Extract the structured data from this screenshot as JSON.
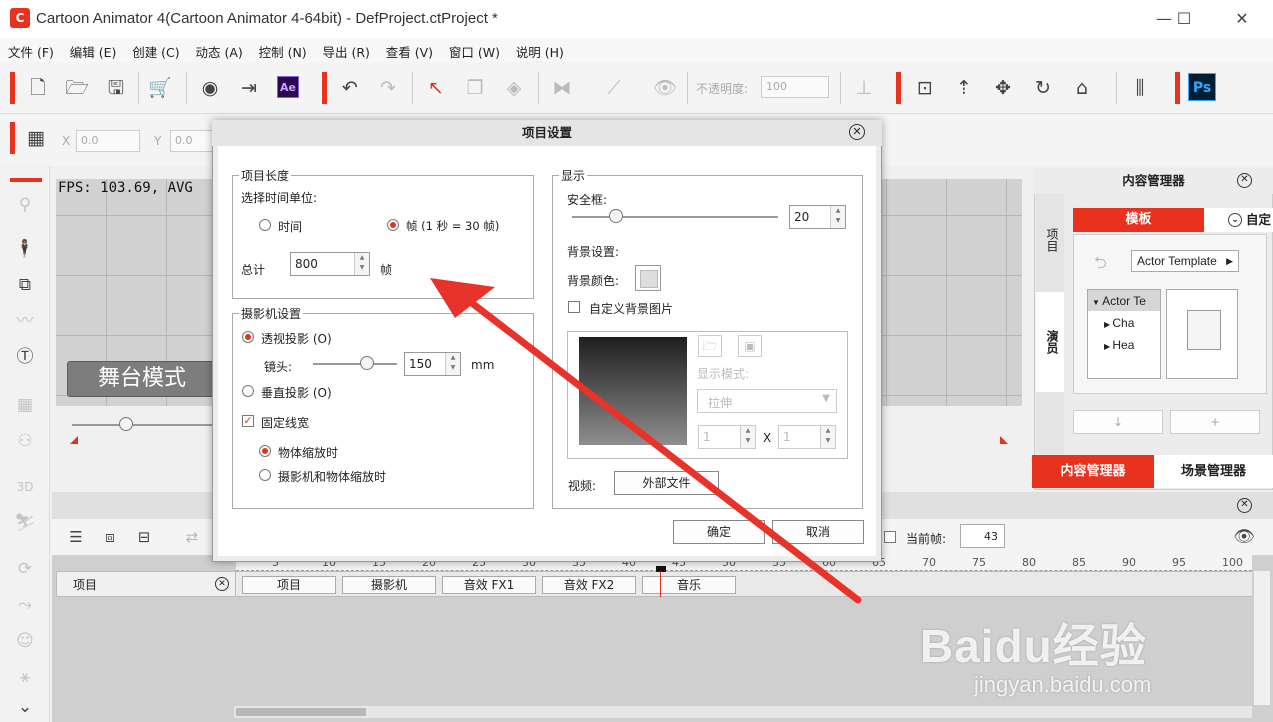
{
  "window": {
    "title": "Cartoon Animator 4(Cartoon Animator 4-64bit) - DefProject.ctProject *",
    "logo_letter": "C"
  },
  "menu": [
    "文件 (F)",
    "编辑 (E)",
    "创建 (C)",
    "动态 (A)",
    "控制 (N)",
    "导出 (R)",
    "查看 (V)",
    "窗口 (W)",
    "说明 (H)"
  ],
  "toolbar": {
    "opacity_label": "不透明度:",
    "opacity_value": "100",
    "ae_label": "Ae",
    "ps_label": "Ps"
  },
  "transform_bar": {
    "x_label": "X",
    "x_value": "0.0",
    "y_label": "Y",
    "y_value": "0.0"
  },
  "stage": {
    "fps_text": "FPS: 103.69, AVG",
    "mode_button": "舞台模式"
  },
  "content_manager": {
    "title": "内容管理器",
    "side_tabs": [
      "项目",
      "演员"
    ],
    "template_tab": "模板",
    "auto_tab": "自定",
    "actor_template_button": "Actor Template",
    "tree_items": [
      "Actor Te",
      "Cha",
      "Hea"
    ],
    "bottom_tabs": [
      "内容管理器",
      "场景管理器"
    ]
  },
  "timeline": {
    "current_frame_label": "当前帧:",
    "current_frame_value": "43",
    "track_header": "项目",
    "tracks": [
      "项目",
      "摄影机",
      "音效 FX1",
      "音效 FX2",
      "音乐"
    ],
    "ruler_ticks": [
      "5",
      "10",
      "15",
      "20",
      "25",
      "30",
      "35",
      "40",
      "45",
      "50",
      "55",
      "60",
      "65",
      "70",
      "75",
      "80",
      "85",
      "90",
      "95",
      "100"
    ]
  },
  "dialog": {
    "title": "项目设置",
    "project_length": {
      "group_title": "项目长度",
      "time_unit_label": "选择时间单位:",
      "time_option": "时间",
      "frame_option": "帧 (1 秒 = 30 帧)",
      "total_label": "总计",
      "total_value": "800",
      "unit": "帧"
    },
    "camera": {
      "group_title": "摄影机设置",
      "perspective": "透视投影 (O)",
      "lens_label": "镜头:",
      "lens_value": "150",
      "lens_unit": "mm",
      "orthographic": "垂直投影 (O)",
      "fixed_line": "固定线宽",
      "object_scale": "物体缩放时",
      "camera_object_scale": "摄影机和物体缩放时"
    },
    "display": {
      "group_title": "显示",
      "safe_frame_label": "安全框:",
      "safe_frame_value": "20",
      "bg_settings_label": "背景设置:",
      "bg_color_label": "背景颜色:",
      "custom_bg_label": "自定义背景图片",
      "display_mode_label": "显示模式:",
      "display_mode_value": "拉伸",
      "size_w": "1",
      "size_x": "X",
      "size_h": "1",
      "video_label": "视频:",
      "external_file_button": "外部文件"
    },
    "ok_button": "确定",
    "cancel_button": "取消"
  },
  "watermark": {
    "brand": "Baidu经验",
    "url": "jingyan.baidu.com"
  },
  "colors": {
    "accent": "#e8321e",
    "arrow": "#e8332a"
  }
}
